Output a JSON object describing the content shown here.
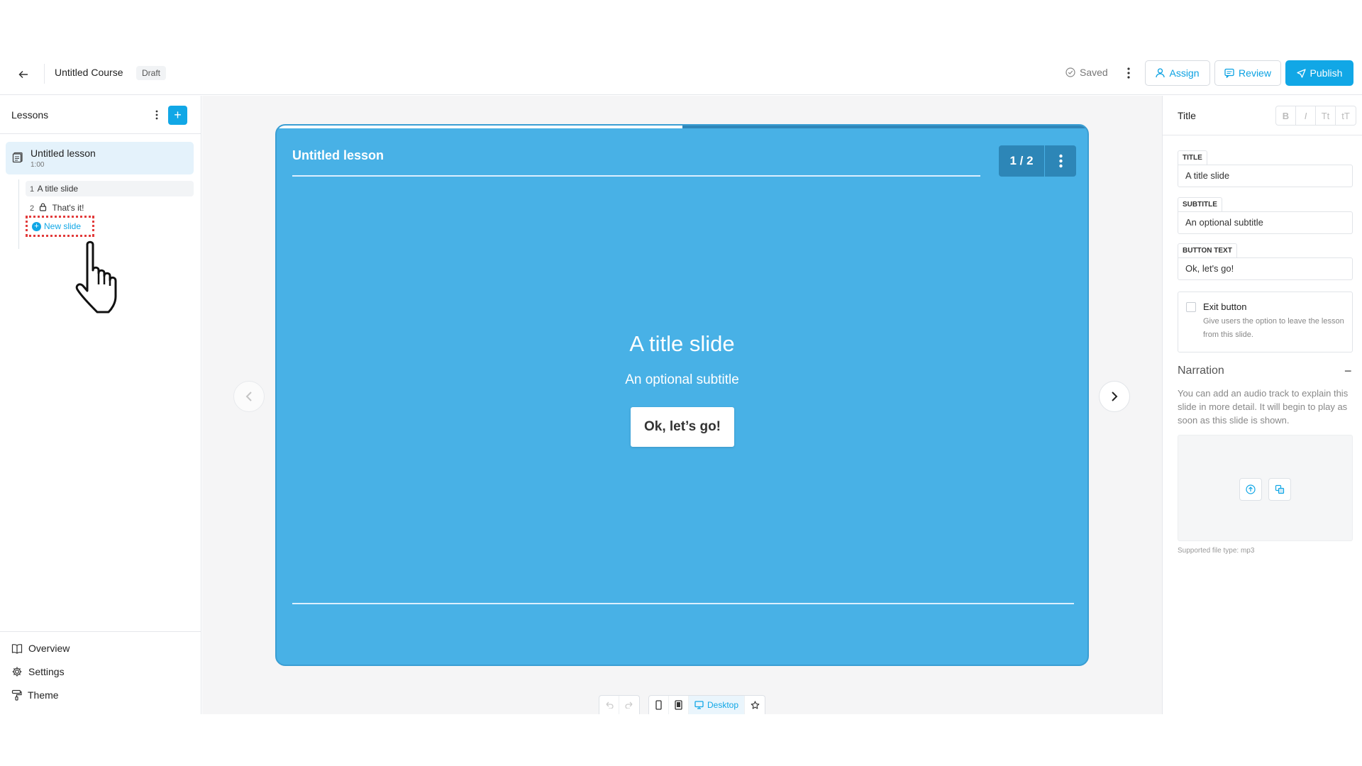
{
  "header": {
    "course_title": "Untitled Course",
    "status_badge": "Draft",
    "saved_label": "Saved",
    "assign_label": "Assign",
    "review_label": "Review",
    "publish_label": "Publish"
  },
  "sidebar": {
    "title": "Lessons",
    "lesson": {
      "name": "Untitled lesson",
      "duration": "1:00"
    },
    "slides": [
      {
        "number": "1",
        "label": "A title slide"
      },
      {
        "number": "2",
        "label": "That's it!"
      }
    ],
    "new_slide_label": "New slide",
    "footer": [
      {
        "label": "Overview"
      },
      {
        "label": "Settings"
      },
      {
        "label": "Theme"
      }
    ]
  },
  "slide": {
    "lesson_title": "Untitled lesson",
    "counter": "1 / 2",
    "progress_fraction": 0.5,
    "heading": "A title slide",
    "subtitle": "An optional subtitle",
    "button_text": "Ok, let’s go!",
    "background_color": "#48b1e6"
  },
  "toolbar": {
    "desktop_label": "Desktop"
  },
  "panel": {
    "title": "Title",
    "format_buttons": [
      "B",
      "I",
      "Tt",
      "tT"
    ],
    "fields": {
      "title_label": "TITLE",
      "title_value": "A title slide",
      "subtitle_label": "SUBTITLE",
      "subtitle_value": "An optional subtitle",
      "button_label": "BUTTON TEXT",
      "button_value": "Ok, let's go!"
    },
    "exit_button": {
      "label": "Exit button",
      "description": "Give users the option to leave the lesson from this slide.",
      "checked": false
    },
    "narration": {
      "title": "Narration",
      "toggle": "−",
      "description": "You can add an audio track to explain this slide in more detail. It will begin to play as soon as this slide is shown.",
      "supported": "Supported file type: mp3"
    }
  },
  "colors": {
    "accent": "#11a7e6",
    "slide_bg": "#48b1e6",
    "counter_bg": "#2d86b7"
  }
}
